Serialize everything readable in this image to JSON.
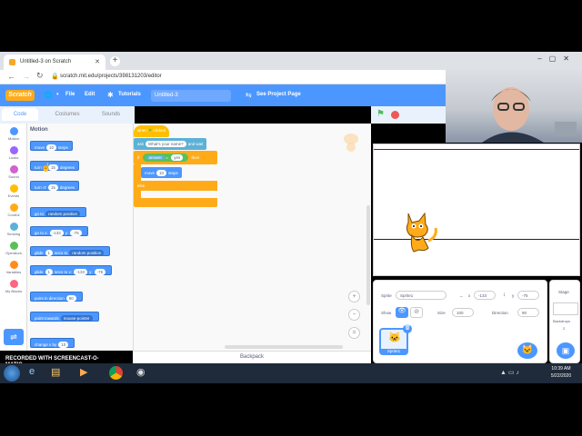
{
  "browser": {
    "tab_title": "Untitled-3 on Scratch",
    "url": "scratch.mit.edu/projects/398131203/editor"
  },
  "menu": {
    "logo": "Scratch",
    "file": "File",
    "edit": "Edit",
    "tutorials": "Tutorials",
    "project_title": "Untitled-3",
    "see_project": "See Project Page"
  },
  "tabs": {
    "code": "Code",
    "costumes": "Costumes",
    "sounds": "Sounds"
  },
  "categories": [
    {
      "label": "Motion",
      "color": "#4c97ff"
    },
    {
      "label": "Looks",
      "color": "#9966ff"
    },
    {
      "label": "Sound",
      "color": "#cf63cf"
    },
    {
      "label": "Events",
      "color": "#ffbf00"
    },
    {
      "label": "Control",
      "color": "#ffab19"
    },
    {
      "label": "Sensing",
      "color": "#5cb1d6"
    },
    {
      "label": "Operators",
      "color": "#59c059"
    },
    {
      "label": "Variables",
      "color": "#ff8c1a"
    },
    {
      "label": "My Blocks",
      "color": "#ff6680"
    }
  ],
  "palette": {
    "heading": "Motion",
    "move": "move",
    "move_val": "10",
    "steps": "steps",
    "turn": "turn",
    "turn_right_val": "15",
    "turn_left_val": "15",
    "degrees": "degrees",
    "goto": "go to",
    "goto_dd": "random position",
    "gotoxy": "go to x:",
    "gotoxy_x": "-133",
    "gotoxy_y_lbl": "y:",
    "gotoxy_y": "-75",
    "glide": "glide",
    "glide_val": "1",
    "secs_to": "secs to",
    "glide_dd": "random position",
    "glidexy_x": "-133",
    "glidexy_y": "-75",
    "secs_to_x": "secs to x:",
    "point_dir": "point in direction",
    "point_dir_val": "90",
    "point_towards": "point towards",
    "point_towards_dd": "mouse-pointer",
    "change_x": "change x by",
    "change_x_val": "10"
  },
  "script": {
    "when_flag": "when",
    "clicked": "clicked",
    "ask": "ask",
    "ask_val": "What's your name?",
    "and_wait": "and wait",
    "if": "if",
    "answer": "answer",
    "eq": "=",
    "yes": "yes",
    "then": "then",
    "move": "move",
    "move_val": "10",
    "steps": "steps",
    "else": "else"
  },
  "sprite_info": {
    "sprite_lbl": "Sprite",
    "sprite_name": "Sprite1",
    "x_lbl": "x",
    "x": "-133",
    "y_lbl": "y",
    "y": "-75",
    "show_lbl": "Show",
    "size_lbl": "Size",
    "size": "100",
    "direction_lbl": "Direction",
    "direction": "90",
    "thumb_label": "Sprite1"
  },
  "stage_panel": {
    "title": "Stage",
    "backdrops_lbl": "Backdrops",
    "backdrops": "2"
  },
  "backpack": "Backpack",
  "watermark": "RECORDED WITH SCREENCAST-O-MATIC",
  "taskbar": {
    "time": "10:39 AM",
    "date": "5/22/2020"
  }
}
